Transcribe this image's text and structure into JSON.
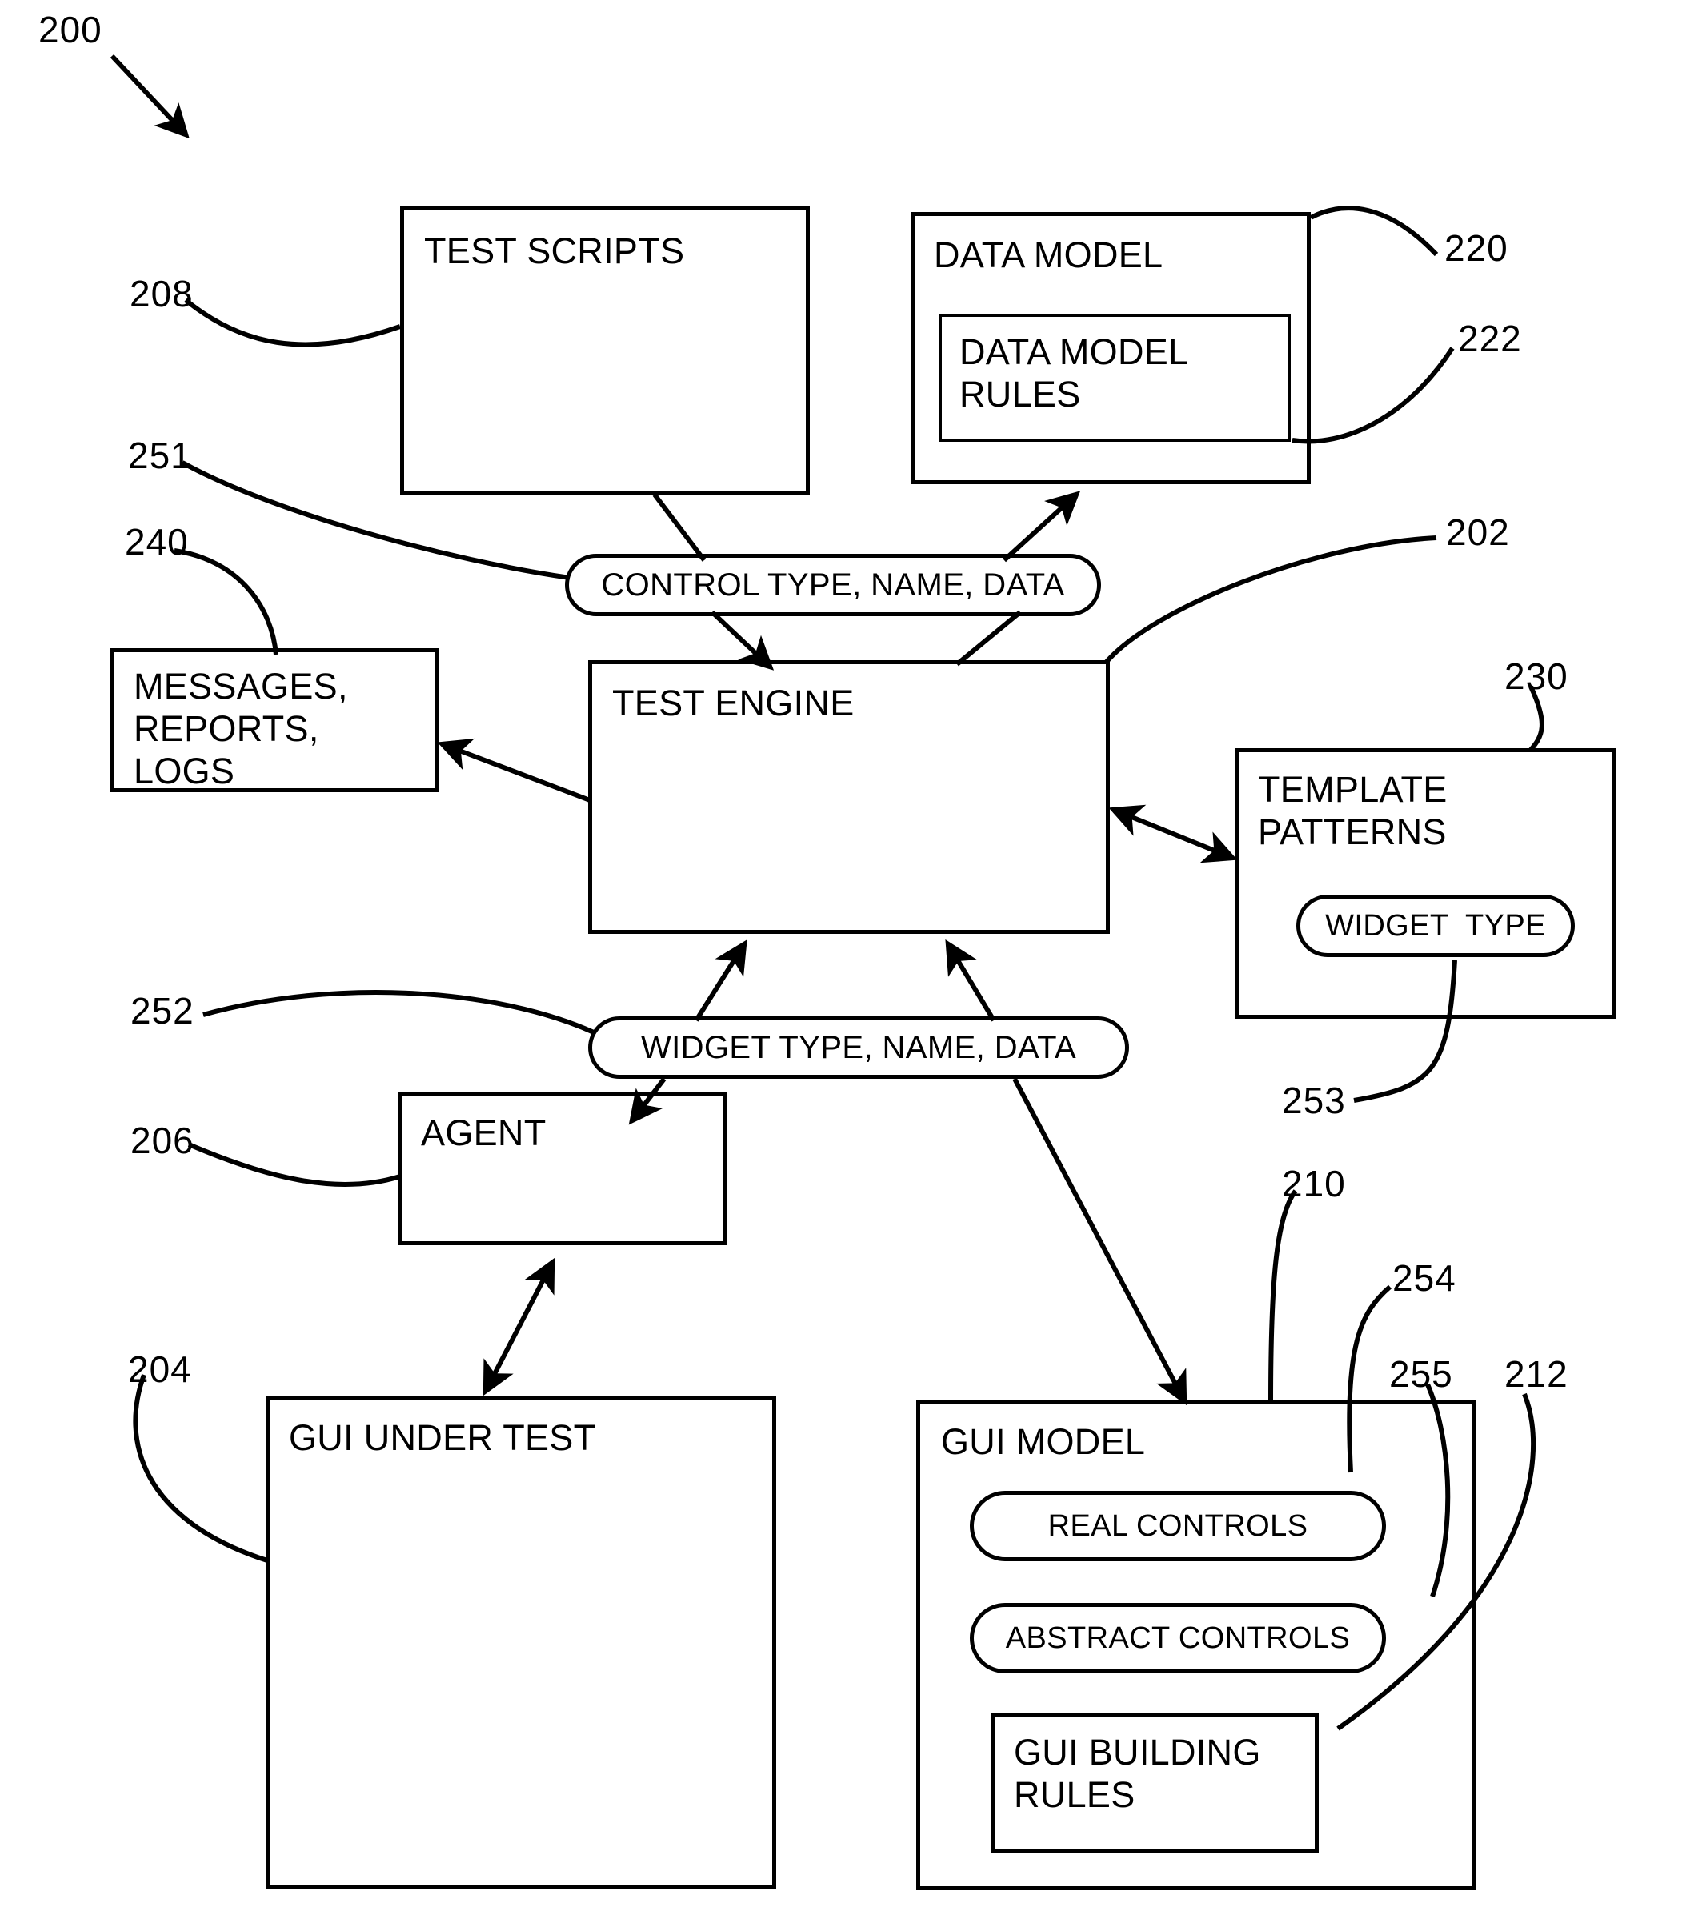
{
  "figure": {
    "number": "200",
    "type": "patent-block-diagram"
  },
  "nodes": {
    "test_scripts": {
      "label": "TEST SCRIPTS",
      "ref": "208"
    },
    "data_model": {
      "label": "DATA MODEL",
      "ref": "220"
    },
    "data_model_rules": {
      "label": "DATA MODEL\nRULES",
      "ref": "222"
    },
    "control_type_pill": {
      "label": "CONTROL TYPE, NAME, DATA",
      "ref": "251"
    },
    "messages": {
      "label": "MESSAGES,\nREPORTS,\nLOGS",
      "ref": "240"
    },
    "test_engine": {
      "label": "TEST ENGINE",
      "ref": "202"
    },
    "template_patterns": {
      "label": "TEMPLATE\nPATTERNS",
      "ref": "230"
    },
    "widget_type_pill": {
      "label": "WIDGET  TYPE",
      "ref": "253"
    },
    "widget_type_name_data_pill": {
      "label": "WIDGET TYPE, NAME, DATA",
      "ref": "252"
    },
    "agent": {
      "label": "AGENT",
      "ref": "206"
    },
    "gui_under_test": {
      "label": "GUI UNDER TEST",
      "ref": "204"
    },
    "gui_model": {
      "label": "GUI MODEL",
      "ref": "210"
    },
    "real_controls": {
      "label": "REAL CONTROLS",
      "ref": "254"
    },
    "abstract_controls": {
      "label": "ABSTRACT CONTROLS",
      "ref": "255"
    },
    "gui_building_rules": {
      "label": "GUI BUILDING\nRULES",
      "ref": "212"
    }
  },
  "reference_numerals": [
    {
      "id": "200",
      "text": "200"
    },
    {
      "id": "208",
      "text": "208"
    },
    {
      "id": "251",
      "text": "251"
    },
    {
      "id": "240",
      "text": "240"
    },
    {
      "id": "220",
      "text": "220"
    },
    {
      "id": "222",
      "text": "222"
    },
    {
      "id": "202",
      "text": "202"
    },
    {
      "id": "230",
      "text": "230"
    },
    {
      "id": "252",
      "text": "252"
    },
    {
      "id": "253",
      "text": "253"
    },
    {
      "id": "206",
      "text": "206"
    },
    {
      "id": "204",
      "text": "204"
    },
    {
      "id": "210",
      "text": "210"
    },
    {
      "id": "254",
      "text": "254"
    },
    {
      "id": "255",
      "text": "255"
    },
    {
      "id": "212",
      "text": "212"
    }
  ],
  "colors": {
    "stroke": "#000000",
    "background": "#ffffff"
  }
}
